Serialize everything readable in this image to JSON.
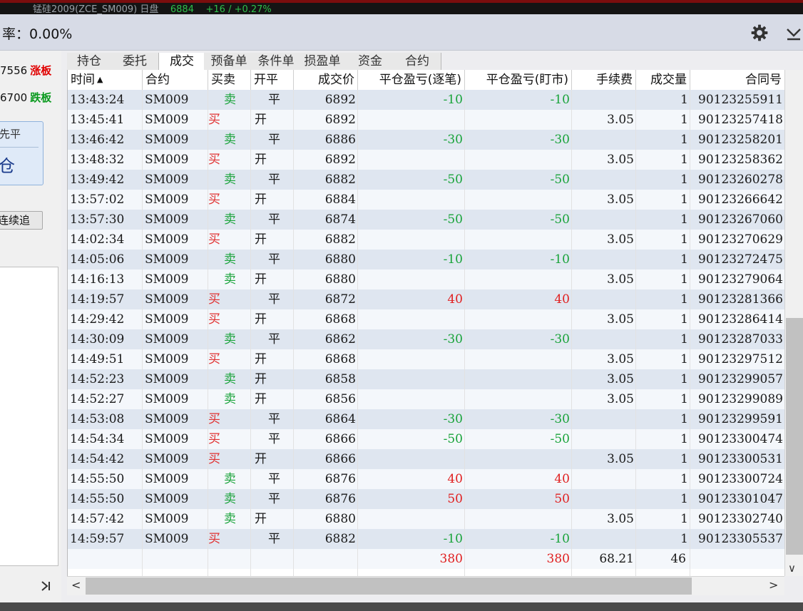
{
  "topbar": {
    "ticker_name": "锰硅2009(ZCE_SM009)  日盘",
    "ticker_price": "6884",
    "ticker_change": "+16 / +0.27%"
  },
  "header": {
    "rate_label": "率：0.00%",
    "icons": [
      "gear-icon",
      "chevron-down-icon"
    ]
  },
  "left_panel": {
    "upper_price": "7556",
    "upper_tag": "涨板",
    "lower_price": "6700",
    "lower_tag": "跌板",
    "order_box_line1": "先平",
    "order_box_line2": "仓",
    "follow_button": "连续追",
    "nav_icon": "next-last-icon",
    "colors": {
      "limit_up": "#e00000",
      "limit_down": "#0a9a1e"
    }
  },
  "tabs": [
    "持仓",
    "委托",
    "成交",
    "预备单",
    "条件单",
    "损盈单",
    "资金",
    "合约"
  ],
  "active_tab": "成交",
  "table": {
    "columns": [
      "时间",
      "合约",
      "买卖",
      "开平",
      "成交价",
      "平仓盈亏(逐笔)",
      "平仓盈亏(盯市)",
      "手续费",
      "成交量",
      "合同号"
    ],
    "sort_indicator": "▲",
    "rows": [
      {
        "time": "13:43:24",
        "contract": "SM009",
        "side": "卖",
        "oc": "平",
        "price": "6892",
        "pnl_trade": "-10",
        "pnl_mtm": "-10",
        "fee": "",
        "qty": "1",
        "order_id": "90123255911"
      },
      {
        "time": "13:45:41",
        "contract": "SM009",
        "side": "买",
        "oc": "开",
        "price": "6892",
        "pnl_trade": "",
        "pnl_mtm": "",
        "fee": "3.05",
        "qty": "1",
        "order_id": "90123257418"
      },
      {
        "time": "13:46:42",
        "contract": "SM009",
        "side": "卖",
        "oc": "平",
        "price": "6886",
        "pnl_trade": "-30",
        "pnl_mtm": "-30",
        "fee": "",
        "qty": "1",
        "order_id": "90123258201"
      },
      {
        "time": "13:48:32",
        "contract": "SM009",
        "side": "买",
        "oc": "开",
        "price": "6892",
        "pnl_trade": "",
        "pnl_mtm": "",
        "fee": "3.05",
        "qty": "1",
        "order_id": "90123258362"
      },
      {
        "time": "13:49:42",
        "contract": "SM009",
        "side": "卖",
        "oc": "平",
        "price": "6882",
        "pnl_trade": "-50",
        "pnl_mtm": "-50",
        "fee": "",
        "qty": "1",
        "order_id": "90123260278"
      },
      {
        "time": "13:57:02",
        "contract": "SM009",
        "side": "买",
        "oc": "开",
        "price": "6884",
        "pnl_trade": "",
        "pnl_mtm": "",
        "fee": "3.05",
        "qty": "1",
        "order_id": "90123266642"
      },
      {
        "time": "13:57:30",
        "contract": "SM009",
        "side": "卖",
        "oc": "平",
        "price": "6874",
        "pnl_trade": "-50",
        "pnl_mtm": "-50",
        "fee": "",
        "qty": "1",
        "order_id": "90123267060"
      },
      {
        "time": "14:02:34",
        "contract": "SM009",
        "side": "买",
        "oc": "开",
        "price": "6882",
        "pnl_trade": "",
        "pnl_mtm": "",
        "fee": "3.05",
        "qty": "1",
        "order_id": "90123270629"
      },
      {
        "time": "14:05:06",
        "contract": "SM009",
        "side": "卖",
        "oc": "平",
        "price": "6880",
        "pnl_trade": "-10",
        "pnl_mtm": "-10",
        "fee": "",
        "qty": "1",
        "order_id": "90123272475"
      },
      {
        "time": "14:16:13",
        "contract": "SM009",
        "side": "卖",
        "oc": "开",
        "price": "6880",
        "pnl_trade": "",
        "pnl_mtm": "",
        "fee": "3.05",
        "qty": "1",
        "order_id": "90123279064"
      },
      {
        "time": "14:19:57",
        "contract": "SM009",
        "side": "买",
        "oc": "平",
        "price": "6872",
        "pnl_trade": "40",
        "pnl_mtm": "40",
        "fee": "",
        "qty": "1",
        "order_id": "90123281366"
      },
      {
        "time": "14:29:42",
        "contract": "SM009",
        "side": "买",
        "oc": "开",
        "price": "6868",
        "pnl_trade": "",
        "pnl_mtm": "",
        "fee": "3.05",
        "qty": "1",
        "order_id": "90123286414"
      },
      {
        "time": "14:30:09",
        "contract": "SM009",
        "side": "卖",
        "oc": "平",
        "price": "6862",
        "pnl_trade": "-30",
        "pnl_mtm": "-30",
        "fee": "",
        "qty": "1",
        "order_id": "90123287033"
      },
      {
        "time": "14:49:51",
        "contract": "SM009",
        "side": "买",
        "oc": "开",
        "price": "6868",
        "pnl_trade": "",
        "pnl_mtm": "",
        "fee": "3.05",
        "qty": "1",
        "order_id": "90123297512"
      },
      {
        "time": "14:52:23",
        "contract": "SM009",
        "side": "卖",
        "oc": "开",
        "price": "6858",
        "pnl_trade": "",
        "pnl_mtm": "",
        "fee": "3.05",
        "qty": "1",
        "order_id": "90123299057"
      },
      {
        "time": "14:52:27",
        "contract": "SM009",
        "side": "卖",
        "oc": "开",
        "price": "6856",
        "pnl_trade": "",
        "pnl_mtm": "",
        "fee": "3.05",
        "qty": "1",
        "order_id": "90123299089"
      },
      {
        "time": "14:53:08",
        "contract": "SM009",
        "side": "买",
        "oc": "平",
        "price": "6864",
        "pnl_trade": "-30",
        "pnl_mtm": "-30",
        "fee": "",
        "qty": "1",
        "order_id": "90123299591"
      },
      {
        "time": "14:54:34",
        "contract": "SM009",
        "side": "买",
        "oc": "平",
        "price": "6866",
        "pnl_trade": "-50",
        "pnl_mtm": "-50",
        "fee": "",
        "qty": "1",
        "order_id": "90123300474"
      },
      {
        "time": "14:54:42",
        "contract": "SM009",
        "side": "买",
        "oc": "开",
        "price": "6866",
        "pnl_trade": "",
        "pnl_mtm": "",
        "fee": "3.05",
        "qty": "1",
        "order_id": "90123300531"
      },
      {
        "time": "14:55:50",
        "contract": "SM009",
        "side": "卖",
        "oc": "平",
        "price": "6876",
        "pnl_trade": "40",
        "pnl_mtm": "40",
        "fee": "",
        "qty": "1",
        "order_id": "90123300724"
      },
      {
        "time": "14:55:50",
        "contract": "SM009",
        "side": "卖",
        "oc": "平",
        "price": "6876",
        "pnl_trade": "50",
        "pnl_mtm": "50",
        "fee": "",
        "qty": "1",
        "order_id": "90123301047"
      },
      {
        "time": "14:57:42",
        "contract": "SM009",
        "side": "卖",
        "oc": "开",
        "price": "6880",
        "pnl_trade": "",
        "pnl_mtm": "",
        "fee": "3.05",
        "qty": "1",
        "order_id": "90123302740"
      },
      {
        "time": "14:59:57",
        "contract": "SM009",
        "side": "买",
        "oc": "平",
        "price": "6882",
        "pnl_trade": "-10",
        "pnl_mtm": "-10",
        "fee": "",
        "qty": "1",
        "order_id": "90123305537"
      }
    ],
    "totals": {
      "pnl_trade": "380",
      "pnl_mtm": "380",
      "fee": "68.21",
      "qty": "46"
    },
    "colors": {
      "buy": "#e03030",
      "sell": "#19a33a",
      "positive": "#e02020",
      "negative": "#19a33a"
    }
  },
  "scrollbars": {
    "left_arrow": "<",
    "right_arrow": ">",
    "down_arrow": "∨"
  }
}
